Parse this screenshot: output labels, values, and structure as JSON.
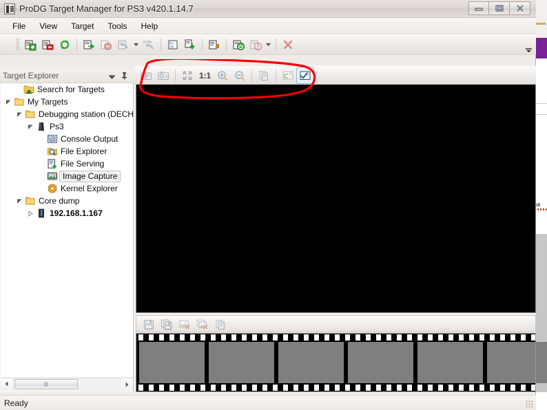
{
  "window": {
    "title": "ProDG Target Manager for PS3 v420.1.14.7",
    "icon": "app-icon",
    "controls": [
      {
        "name": "minimize-button",
        "glyph": "minimize"
      },
      {
        "name": "restore-button",
        "glyph": "restore"
      },
      {
        "name": "close-button",
        "glyph": "close"
      }
    ]
  },
  "menubar": {
    "items": [
      {
        "label": "File"
      },
      {
        "label": "View"
      },
      {
        "label": "Target"
      },
      {
        "label": "Tools"
      },
      {
        "label": "Help"
      }
    ]
  },
  "main_toolbar": {
    "overflow_label": "toolbar-overflow-chevron",
    "buttons": [
      {
        "name": "add-target-button",
        "icon": "add-target-icon",
        "tooltip": "Add Target"
      },
      {
        "name": "remove-target-button",
        "icon": "remove-target-icon",
        "tooltip": "Remove Target"
      },
      {
        "name": "refresh-targets-button",
        "icon": "refresh-icon",
        "tooltip": "Refresh"
      },
      {
        "sep": true
      },
      {
        "name": "connect-target-button",
        "icon": "connect-icon",
        "tooltip": "Connect"
      },
      {
        "name": "disconnect-target-button",
        "icon": "disconnect-icon",
        "tooltip": "Disconnect"
      },
      {
        "name": "reset-target-button",
        "icon": "reset-icon",
        "tooltip": "Reset",
        "has_arrow": true
      },
      {
        "name": "xmb-button",
        "icon": "xmb-icon",
        "tooltip": "XMB"
      },
      {
        "sep": true
      },
      {
        "name": "memory-button",
        "icon": "memory-icon",
        "tooltip": "Memory"
      },
      {
        "name": "download-button",
        "icon": "download-icon",
        "tooltip": "Download"
      },
      {
        "sep": true
      },
      {
        "name": "target-info-button",
        "icon": "info-icon",
        "tooltip": "Target Information"
      },
      {
        "sep": true
      },
      {
        "name": "power-on-button",
        "icon": "power-on-icon",
        "tooltip": "Power On"
      },
      {
        "name": "power-off-button",
        "icon": "power-off-icon",
        "tooltip": "Power Off",
        "has_arrow": true
      },
      {
        "sep": true
      },
      {
        "name": "cancel-button",
        "icon": "cancel-x-icon",
        "tooltip": "Cancel"
      }
    ]
  },
  "explorer": {
    "title": "Target Explorer",
    "dropdown_icon": "chevron-down-icon",
    "pin_icon": "pin-icon",
    "tree": [
      {
        "label": "Search for Targets",
        "indent": 1,
        "icon": "search-targets-icon",
        "twisty": "none",
        "selected": false,
        "bold": false
      },
      {
        "label": "My Targets",
        "indent": 1,
        "icon": "folder-icon",
        "twisty": "expanded",
        "selected": false,
        "bold": false
      },
      {
        "label": "Debugging station (DECH",
        "indent": 2,
        "icon": "folder-icon",
        "twisty": "expanded",
        "selected": false,
        "bold": false
      },
      {
        "label": "Ps3",
        "indent": 3,
        "icon": "console-icon",
        "twisty": "expanded",
        "selected": false,
        "bold": false
      },
      {
        "label": "Console Output",
        "indent": 4,
        "icon": "console-output-icon",
        "twisty": "none",
        "selected": false,
        "bold": false
      },
      {
        "label": "File Explorer",
        "indent": 4,
        "icon": "file-explorer-icon",
        "twisty": "none",
        "selected": false,
        "bold": false
      },
      {
        "label": "File Serving",
        "indent": 4,
        "icon": "file-serving-icon",
        "twisty": "none",
        "selected": false,
        "bold": false
      },
      {
        "label": "Image Capture",
        "indent": 4,
        "icon": "image-capture-icon",
        "twisty": "none",
        "selected": true,
        "bold": false
      },
      {
        "label": "Kernel Explorer",
        "indent": 4,
        "icon": "kernel-explorer-icon",
        "twisty": "none",
        "selected": false,
        "bold": false
      },
      {
        "label": "Core dump",
        "indent": 2,
        "icon": "folder-icon",
        "twisty": "expanded",
        "selected": false,
        "bold": false
      },
      {
        "label": "192.168.1.167",
        "indent": 3,
        "icon": "network-target-icon",
        "twisty": "collapsed",
        "selected": false,
        "bold": true
      }
    ],
    "hscroll": {
      "left_arrow": "scroll-left-icon",
      "right_arrow": "scroll-right-icon"
    }
  },
  "capture": {
    "toolbar": [
      {
        "name": "capture-image-button",
        "icon": "camera-icon",
        "tooltip": "Capture Image",
        "disabled": true
      },
      {
        "name": "capture-settings-button",
        "icon": "camera-settings-icon",
        "tooltip": "Capture Settings",
        "disabled": true
      },
      {
        "sep": true
      },
      {
        "name": "fit-to-window-button",
        "icon": "fit-screen-icon",
        "tooltip": "Fit To Window",
        "disabled": true
      },
      {
        "name": "actual-size-button",
        "label": "1:1",
        "tooltip": "Actual Size",
        "disabled": true
      },
      {
        "name": "zoom-in-button",
        "icon": "zoom-in-icon",
        "tooltip": "Zoom In",
        "disabled": true
      },
      {
        "name": "zoom-out-button",
        "icon": "zoom-out-icon",
        "tooltip": "Zoom Out",
        "disabled": true
      },
      {
        "sep": true
      },
      {
        "name": "copy-image-button",
        "icon": "copy-icon",
        "tooltip": "Copy",
        "disabled": true
      },
      {
        "sep": true
      },
      {
        "name": "auto-refresh-button",
        "icon": "auto-refresh-icon",
        "tooltip": "Auto Refresh",
        "disabled": true
      },
      {
        "name": "capture-options-button",
        "icon": "options-checkbox-icon",
        "tooltip": "Options",
        "disabled": false
      }
    ],
    "viewport": {
      "name": "image-viewport",
      "background": "#000000"
    },
    "strip_toolbar": [
      {
        "name": "save-image-button",
        "icon": "save-icon",
        "tooltip": "Save Image",
        "disabled": true
      },
      {
        "name": "save-all-images-button",
        "icon": "save-all-icon",
        "tooltip": "Save All Images",
        "disabled": true
      },
      {
        "name": "delete-image-button",
        "icon": "delete-image-icon",
        "tooltip": "Delete Image",
        "disabled": true
      },
      {
        "name": "delete-all-images-button",
        "icon": "delete-all-images-icon",
        "tooltip": "Delete All Images",
        "disabled": true
      },
      {
        "name": "copy-thumbnail-button",
        "icon": "copy-icon",
        "tooltip": "Copy",
        "disabled": true
      }
    ],
    "filmstrip": {
      "frame_count": 6,
      "frame_color": "#7f7f7f",
      "strip_color": "#000000"
    }
  },
  "statusbar": {
    "text": "Ready",
    "grip": "resize-grip-icon"
  },
  "annotation": {
    "type": "hand-drawn-ellipse",
    "color": "#f60000",
    "target": "capture-toolbar"
  },
  "background": {
    "right_text": "na"
  },
  "colors": {
    "accent_red": "#f60000",
    "viewport_black": "#000000",
    "frame_gray": "#7f7f7f",
    "window_chrome": "#f0ece9"
  }
}
